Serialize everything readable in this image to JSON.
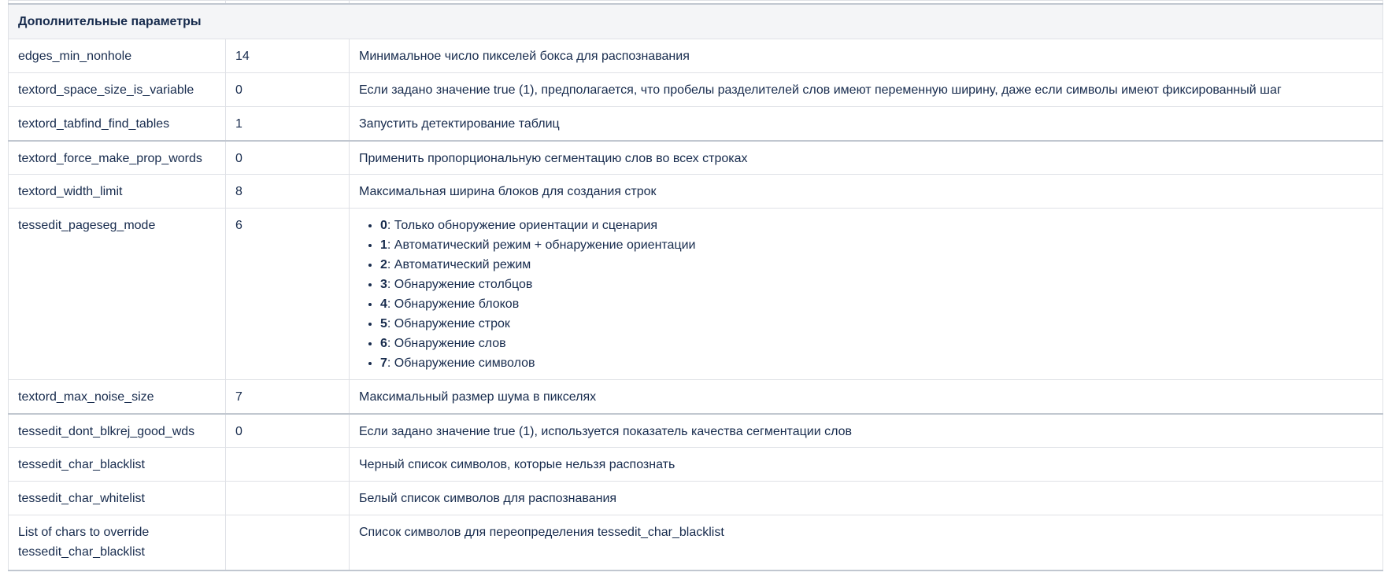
{
  "section_title": "Дополнительные параметры",
  "rows": [
    {
      "name": "edges_min_nonhole",
      "value": "14",
      "desc": "Минимальное число пикселей бокса для распознавания"
    },
    {
      "name": "textord_space_size_is_variable",
      "value": "0",
      "desc": "Если задано значение true (1), предполагается, что пробелы разделителей слов имеют переменную ширину, даже если символы имеют фиксированный шаг"
    },
    {
      "name": "textord_tabfind_find_tables",
      "value": "1",
      "desc": "Запустить детектирование таблиц"
    },
    {
      "name": "textord_force_make_prop_words",
      "value": "0",
      "desc": "Применить пропорциональную сегментацию слов во всех строках"
    },
    {
      "name": "textord_width_limit",
      "value": "8",
      "desc": "Максимальная ширина блоков для создания строк"
    },
    {
      "name": "tessedit_pageseg_mode",
      "value": "6",
      "desc_list": [
        {
          "num": "0",
          "text": ": Только обноружение ориентации и сценария"
        },
        {
          "num": "1",
          "text": ": Автоматический режим + обнаружение ориентации"
        },
        {
          "num": "2",
          "text": ": Автоматический режим"
        },
        {
          "num": "3",
          "text": ": Обнаружение столбцов"
        },
        {
          "num": "4",
          "text": ": Обнаружение блоков"
        },
        {
          "num": "5",
          "text": ": Обнаружение строк"
        },
        {
          "num": "6",
          "text": ": Обнаружение слов"
        },
        {
          "num": "7",
          "text": ": Обнаружение символов"
        }
      ]
    },
    {
      "name": "textord_max_noise_size",
      "value": "7",
      "desc": "Максимальный размер шума в пикселях"
    },
    {
      "name": "tessedit_dont_blkrej_good_wds",
      "value": "0",
      "desc": "Если задано значение true (1), используется показатель качества сегментации слов"
    },
    {
      "name": "tessedit_char_blacklist",
      "value": "",
      "desc": "Черный список символов, которые нельзя распознать"
    },
    {
      "name": "tessedit_char_whitelist",
      "value": "",
      "desc": "Белый список символов для распознавания"
    },
    {
      "name_line1": "List of chars to override",
      "name_line2": "tessedit_char_blacklist",
      "value": "",
      "desc": "Список символов для переопределения tessedit_char_blacklist"
    }
  ]
}
